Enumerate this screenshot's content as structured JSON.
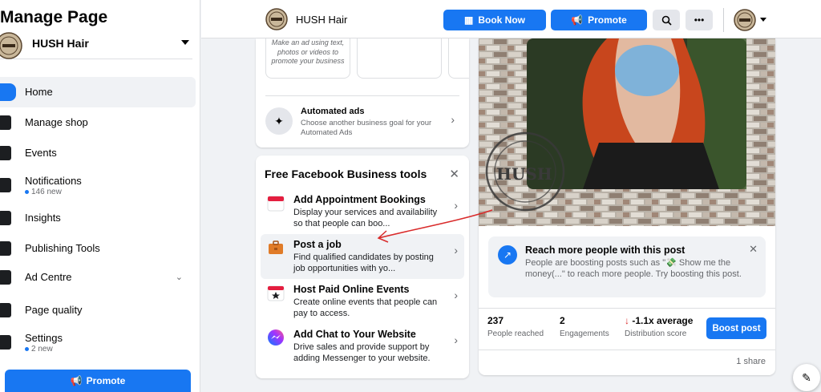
{
  "sidebar": {
    "title": "Manage Page",
    "page_name": "HUSH Hair",
    "items": [
      {
        "label": "Home",
        "icon": "home-icon"
      },
      {
        "label": "Manage shop",
        "icon": "shop-icon"
      },
      {
        "label": "Events",
        "icon": "events-icon"
      },
      {
        "label": "Notifications",
        "sub": "146 new",
        "icon": "bell-icon"
      },
      {
        "label": "Insights",
        "icon": "insights-icon"
      },
      {
        "label": "Publishing Tools",
        "icon": "publishing-icon"
      },
      {
        "label": "Ad Centre",
        "icon": "megaphone-icon"
      },
      {
        "label": "Page quality",
        "icon": "quality-icon"
      },
      {
        "label": "Settings",
        "sub": "2 new",
        "icon": "gear-icon"
      }
    ],
    "promote_label": "Promote"
  },
  "topbar": {
    "page_name": "HUSH Hair",
    "book_now": "Book Now",
    "promote": "Promote",
    "more": "•••"
  },
  "ads": {
    "tile_text": "Make an ad using text, photos or videos to promote your business",
    "automated_title": "Automated ads",
    "automated_desc": "Choose another business goal for your Automated Ads"
  },
  "tools": {
    "header": "Free Facebook Business tools",
    "items": [
      {
        "title": "Add Appointment Bookings",
        "desc": "Display your services and availability so that people can boo..."
      },
      {
        "title": "Post a job",
        "desc": "Find qualified candidates by posting job opportunities with yo..."
      },
      {
        "title": "Host Paid Online Events",
        "desc": "Create online events that people can pay to access."
      },
      {
        "title": "Add Chat to Your Website",
        "desc": "Drive sales and provide support by adding Messenger to your website."
      }
    ]
  },
  "post": {
    "logo_text": "HUSH",
    "reach_title": "Reach more people with this post",
    "reach_desc": "People are boosting posts such as \"💸 Show me the money(...\" to reach more people. Try boosting this post.",
    "stats": [
      {
        "num": "237",
        "label": "People reached"
      },
      {
        "num": "2",
        "label": "Engagements"
      },
      {
        "num": "-1.1x average",
        "label": "Distribution score"
      }
    ],
    "boost_label": "Boost post",
    "shares": "1 share"
  },
  "colors": {
    "accent": "#1877f2",
    "annotation": "#d92b2b"
  }
}
